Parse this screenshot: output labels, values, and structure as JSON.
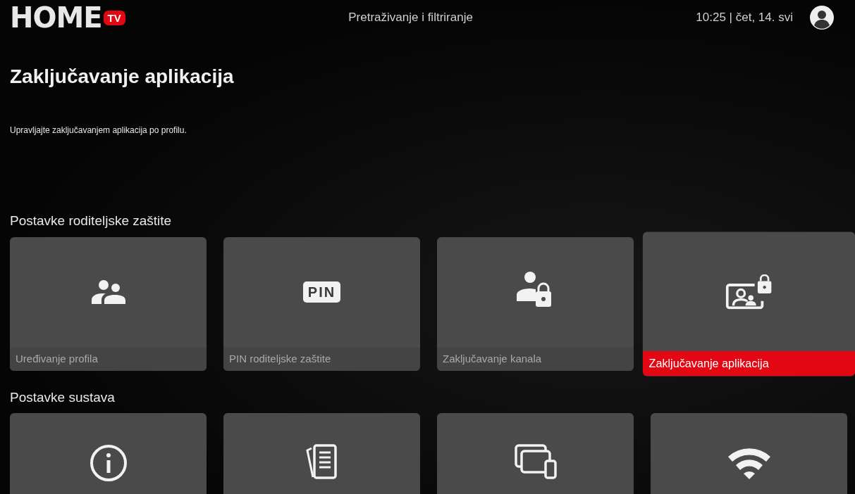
{
  "header": {
    "logo_text": "HOME",
    "logo_badge": "TV",
    "title": "Pretraživanje i filtriranje",
    "time_date": "10:25 | čet, 14. svi"
  },
  "page": {
    "title": "Zaključavanje aplikacija",
    "description": "Upravljajte zaključavanjem aplikacija po profilu."
  },
  "sections": [
    {
      "title": "Postavke roditeljske zaštite",
      "tiles": [
        {
          "kind": "profiles",
          "label": "Uređivanje profila",
          "selected": false
        },
        {
          "kind": "pin",
          "badge": "PIN",
          "label": "PIN roditeljske zaštite",
          "selected": false
        },
        {
          "kind": "channel-lock",
          "label": "Zaključavanje kanala",
          "selected": false
        },
        {
          "kind": "app-lock",
          "label": "Zaključavanje aplikacija",
          "selected": true
        }
      ]
    },
    {
      "title": "Postavke sustava",
      "tiles": [
        {
          "kind": "info",
          "selected": false
        },
        {
          "kind": "documents",
          "selected": false
        },
        {
          "kind": "devices",
          "selected": false
        },
        {
          "kind": "wifi",
          "selected": false
        }
      ]
    }
  ]
}
